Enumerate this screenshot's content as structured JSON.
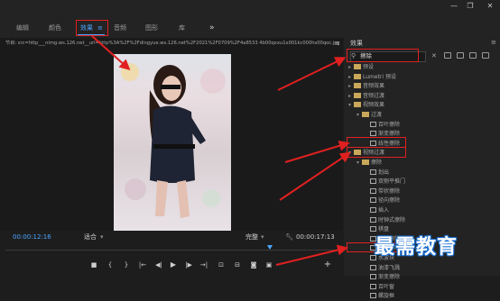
{
  "window": {
    "minimize": "—",
    "maximize": "❐",
    "close": "✕"
  },
  "tabs": [
    {
      "label": "编辑"
    },
    {
      "label": "颜色"
    },
    {
      "label": "效果"
    },
    {
      "label": "音频"
    },
    {
      "label": "图形"
    },
    {
      "label": "库"
    }
  ],
  "tabs_more": "»",
  "tabs_menu": "≡",
  "monitor": {
    "title": "节目: src=http___nimg.ws.126.net__url=http%3A%2F%2Fdingyue.ws.126.net%2F2021%2F0709%2F4a8533 4b00qxxu1x001kc000hs00qoc.jpg&thumbnail",
    "menu": "≡",
    "timecode_current": "00:00:12:16",
    "fit_label": "适合",
    "quality_label": "完整",
    "timecode_total": "00:00:17:13"
  },
  "transport": {
    "mark_in": "{",
    "mark_out": "}",
    "go_in": "|←",
    "step_back": "◀|",
    "play": "▶",
    "step_forward": "|▶",
    "go_out": "→|",
    "lift": "⊡",
    "extract": "⊟",
    "export_frame": "◙",
    "compare": "▣",
    "add": "+"
  },
  "effects_panel": {
    "title": "效果",
    "menu": "≡",
    "search_value": "擦除",
    "clear": "✕",
    "tree": [
      {
        "label": "预设",
        "kind": "folder",
        "level": 0
      },
      {
        "label": "Lumetri 预设",
        "kind": "folder",
        "level": 0
      },
      {
        "label": "音频效果",
        "kind": "folder",
        "level": 0
      },
      {
        "label": "音频过渡",
        "kind": "folder",
        "level": 0
      },
      {
        "label": "视频效果",
        "kind": "folder",
        "level": 0
      },
      {
        "label": "过渡",
        "kind": "folder",
        "level": 1
      },
      {
        "label": "百叶擦除",
        "kind": "fx",
        "level": 2
      },
      {
        "label": "渐变擦除",
        "kind": "fx",
        "level": 2
      },
      {
        "label": "线性擦除",
        "kind": "fx",
        "level": 2
      },
      {
        "label": "视频过渡",
        "kind": "folder",
        "level": 0
      },
      {
        "label": "擦除",
        "kind": "folder",
        "level": 1
      },
      {
        "label": "划出",
        "kind": "fx",
        "level": 2
      },
      {
        "label": "双侧平推门",
        "kind": "fx",
        "level": 2
      },
      {
        "label": "带状擦除",
        "kind": "fx",
        "level": 2
      },
      {
        "label": "径向擦除",
        "kind": "fx",
        "level": 2
      },
      {
        "label": "插入",
        "kind": "fx",
        "level": 2
      },
      {
        "label": "时钟式擦除",
        "kind": "fx",
        "level": 2
      },
      {
        "label": "棋盘",
        "kind": "fx",
        "level": 2
      },
      {
        "label": "棋盘擦除",
        "kind": "fx",
        "level": 2
      },
      {
        "label": "楔形擦除",
        "kind": "fx",
        "level": 2
      },
      {
        "label": "水波块",
        "kind": "fx",
        "level": 2
      },
      {
        "label": "油漆飞溅",
        "kind": "fx",
        "level": 2
      },
      {
        "label": "渐变擦除",
        "kind": "fx",
        "level": 2
      },
      {
        "label": "百叶窗",
        "kind": "fx",
        "level": 2
      },
      {
        "label": "螺旋框",
        "kind": "fx",
        "level": 2
      }
    ]
  },
  "watermark": "最需教育",
  "colors": {
    "accent": "#4aa6ff",
    "annotation_red": "#e02020",
    "folder": "#c9a85a"
  }
}
